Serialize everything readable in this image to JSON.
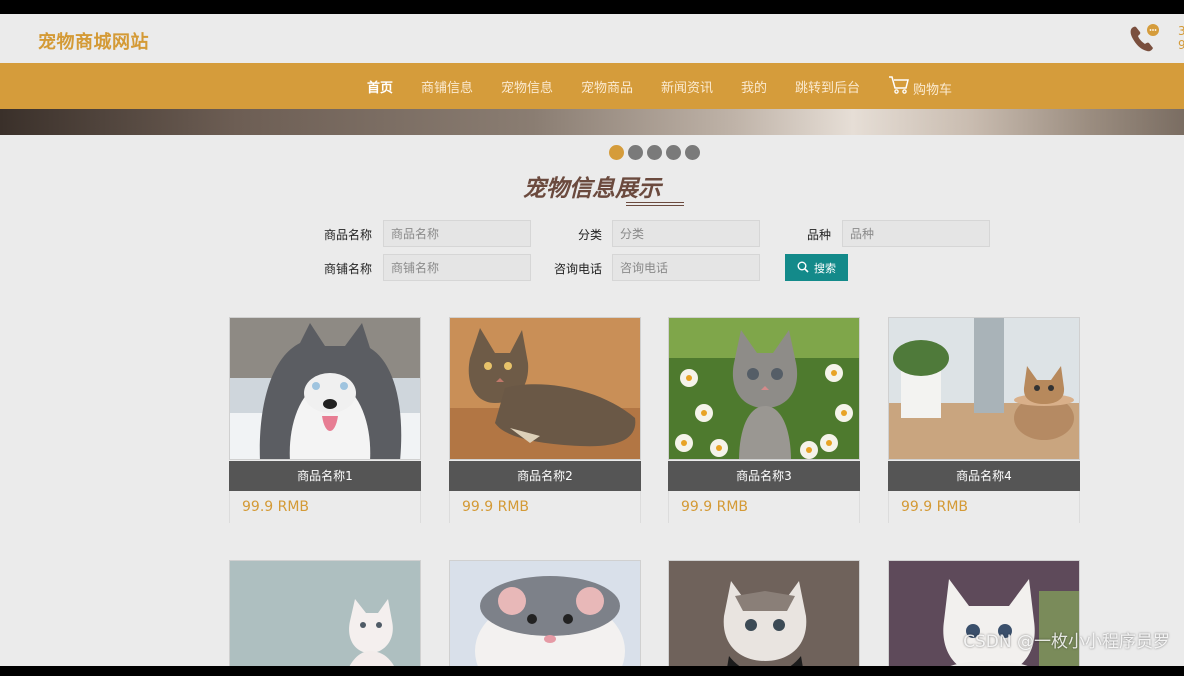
{
  "header": {
    "logo": "宠物商城网站",
    "phone_digits": "3\n9"
  },
  "nav": {
    "items": [
      "首页",
      "商铺信息",
      "宠物信息",
      "宠物商品",
      "新闻资讯",
      "我的",
      "跳转到后台"
    ],
    "cart": "购物车",
    "active_index": 0
  },
  "carousel": {
    "dot_count": 5,
    "active_dot": 0
  },
  "section": {
    "title": "宠物信息展示"
  },
  "search": {
    "product_name_label": "商品名称",
    "product_name_placeholder": "商品名称",
    "category_label": "分类",
    "category_placeholder": "分类",
    "breed_label": "品种",
    "breed_placeholder": "品种",
    "shop_name_label": "商铺名称",
    "shop_name_placeholder": "商铺名称",
    "phone_label": "咨询电话",
    "phone_placeholder": "咨询电话",
    "button": "搜索"
  },
  "products": [
    {
      "name": "商品名称1",
      "price": "99.9 RMB",
      "image": "husky-dog"
    },
    {
      "name": "商品名称2",
      "price": "99.9 RMB",
      "image": "tabby-cat"
    },
    {
      "name": "商品名称3",
      "price": "99.9 RMB",
      "image": "kitten-flowers"
    },
    {
      "name": "商品名称4",
      "price": "99.9 RMB",
      "image": "kitten-bowl"
    },
    {
      "name": "",
      "price": "",
      "image": "white-cat"
    },
    {
      "name": "",
      "price": "",
      "image": "rat"
    },
    {
      "name": "",
      "price": "",
      "image": "cat-bandana"
    },
    {
      "name": "",
      "price": "",
      "image": "white-kitten"
    }
  ],
  "watermark": "CSDN @一枚小小程序员罗",
  "colors": {
    "accent": "#d59c3b",
    "search_button": "#138a8a",
    "title": "#6b4a3e"
  }
}
